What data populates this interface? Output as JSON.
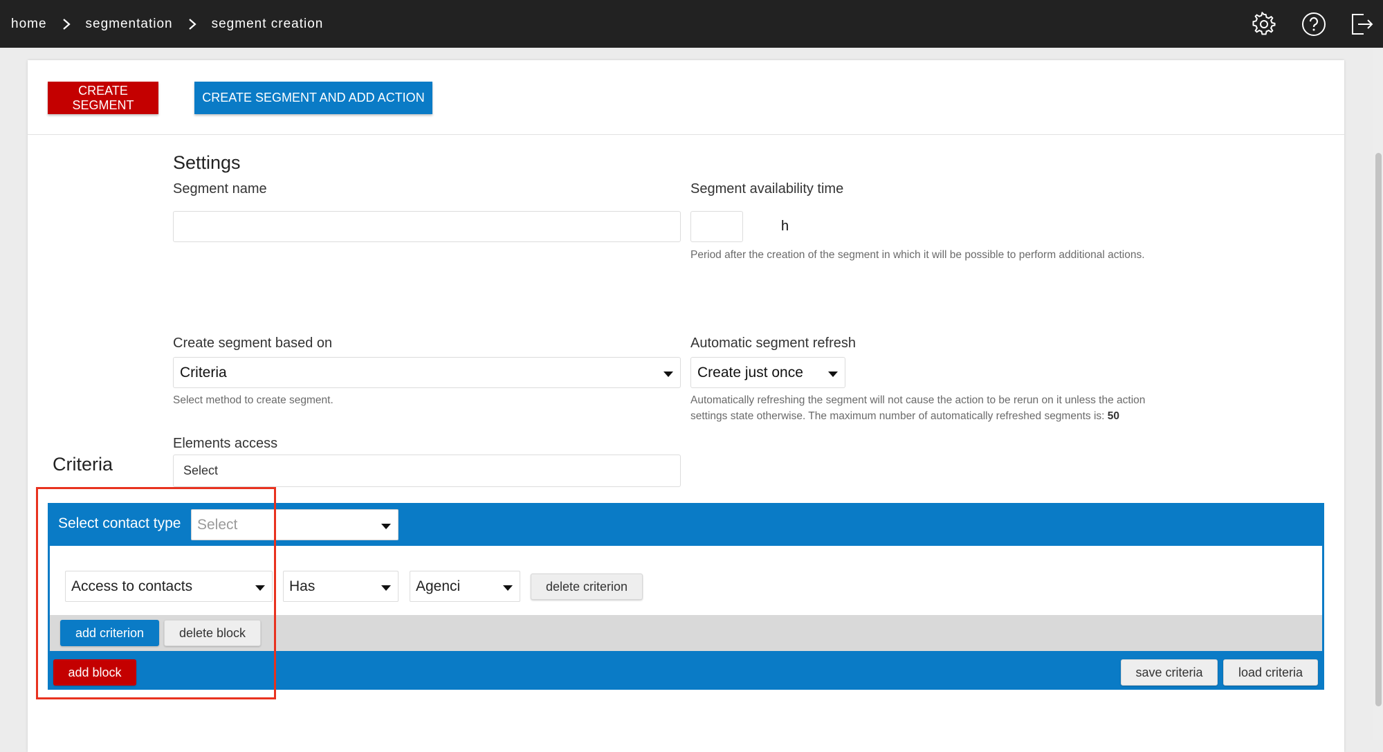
{
  "breadcrumb": [
    "home",
    "segmentation",
    "segment creation"
  ],
  "toolbar": {
    "create_segment": "CREATE SEGMENT",
    "create_segment_and_add_action": "CREATE SEGMENT AND ADD ACTION"
  },
  "settings": {
    "title": "Settings",
    "segment_name": {
      "label": "Segment name",
      "value": ""
    },
    "availability": {
      "label": "Segment availability time",
      "value": "",
      "unit": "h",
      "hint": "Period after the creation of the segment in which it will be possible to perform additional actions."
    },
    "based_on": {
      "label": "Create segment based on",
      "value": "Criteria",
      "hint": "Select method to create segment."
    },
    "refresh": {
      "label": "Automatic segment refresh",
      "value": "Create just once",
      "hint_line1": "Automatically refreshing the segment will not cause the action to be rerun on it unless the action",
      "hint_line2": "settings state otherwise. The maximum number of automatically refreshed segments is:",
      "max_count": "50"
    },
    "elements_access": {
      "label": "Elements access",
      "placeholder": "Select"
    }
  },
  "criteria": {
    "title": "Criteria",
    "contact_type_label": "Select contact type",
    "contact_type_placeholder": "Select",
    "rows": [
      {
        "field": "Access to contacts",
        "operator": "Has",
        "value": "Agenci",
        "delete_label": "delete criterion"
      }
    ],
    "add_criterion": "add criterion",
    "delete_block": "delete block",
    "add_block": "add block",
    "save_criteria": "save criteria",
    "load_criteria": "load criteria"
  },
  "colors": {
    "topbar": "#222222",
    "primary_red": "#c40000",
    "primary_blue": "#0a7bc6",
    "highlight": "#e8321f"
  },
  "icons": [
    "chevron-right-icon",
    "gear-icon",
    "help-icon",
    "logout-icon"
  ]
}
